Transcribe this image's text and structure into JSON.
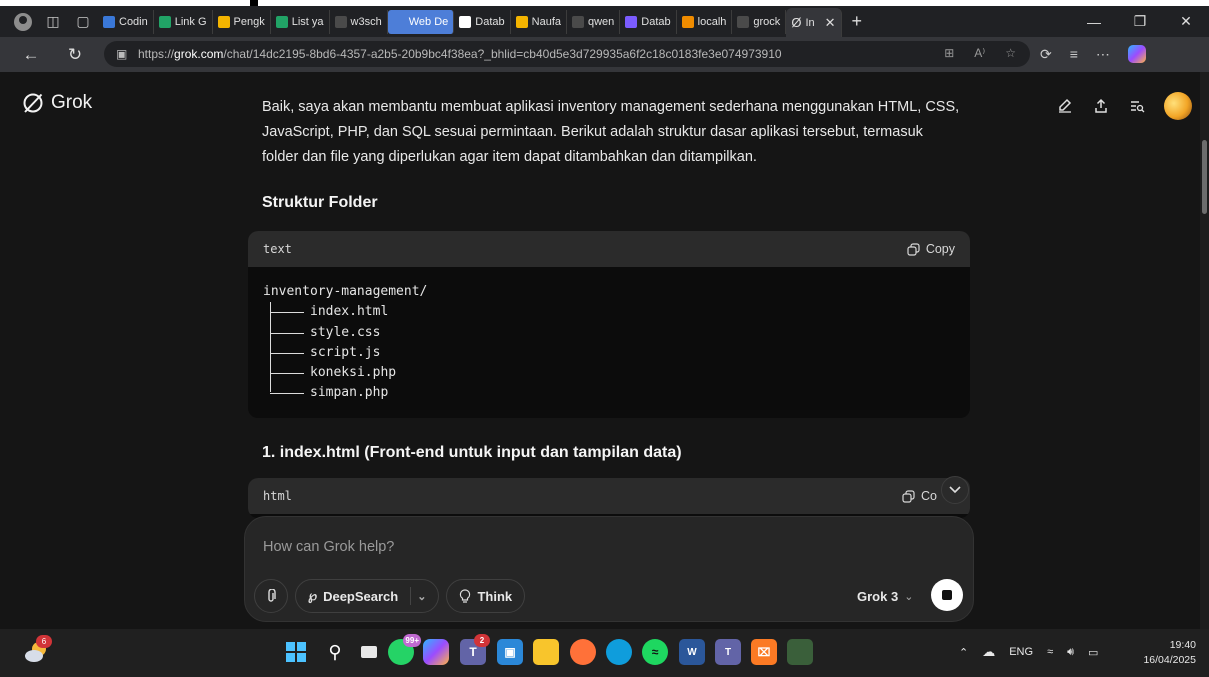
{
  "browser": {
    "tabs": [
      {
        "label": "Codin",
        "color": "#3a78d8"
      },
      {
        "label": "Link G",
        "color": "#21a366"
      },
      {
        "label": "Pengk",
        "color": "#f4b400"
      },
      {
        "label": "List ya",
        "color": "#21a366"
      },
      {
        "label": "w3sch",
        "color": "#4a4a4a"
      },
      {
        "label": "Web De",
        "color": "#4d7ed8"
      },
      {
        "label": "Datab",
        "color": "#ffffff"
      },
      {
        "label": "Naufa",
        "color": "#f4b400"
      },
      {
        "label": "qwen",
        "color": "#4a4a4a"
      },
      {
        "label": "Datab",
        "color": "#7b5cff"
      },
      {
        "label": "localh",
        "color": "#f08c00"
      },
      {
        "label": "grock",
        "color": "#4a4a4a"
      }
    ],
    "active_tab_label": "In",
    "url_prefix": "https://",
    "url_host": "grok.com",
    "url_path": "/chat/14dc2195-8bd6-4357-a2b5-20b9bc4f38ea?_bhlid=cb40d5e3d729935a6f2c18c0183fe3e074973910"
  },
  "app": {
    "name": "Grok"
  },
  "message": {
    "intro": "Baik, saya akan membantu membuat aplikasi inventory management sederhana menggunakan HTML, CSS, JavaScript, PHP, dan SQL sesuai permintaan. Berikut adalah struktur dasar aplikasi tersebut, termasuk folder dan file yang diperlukan agar item dapat ditambahkan dan ditampilkan.",
    "heading_folder": "Struktur Folder",
    "code1": {
      "lang": "text",
      "copy_label": "Copy",
      "root": "inventory-management/",
      "files": [
        "index.html",
        "style.css",
        "script.js",
        "koneksi.php",
        "simpan.php"
      ]
    },
    "heading_index": "1. index.html (Front-end untuk input dan tampilan data)",
    "code2": {
      "lang": "html",
      "copy_label": "Co"
    }
  },
  "composer": {
    "placeholder": "How can Grok help?",
    "deepsearch_label": "DeepSearch",
    "think_label": "Think",
    "model_label": "Grok 3"
  },
  "taskbar": {
    "weather_badge": "6",
    "whatsapp_badge": "99+",
    "teams_badge": "2",
    "language": "ENG",
    "time": "19:40",
    "date": "16/04/2025"
  }
}
